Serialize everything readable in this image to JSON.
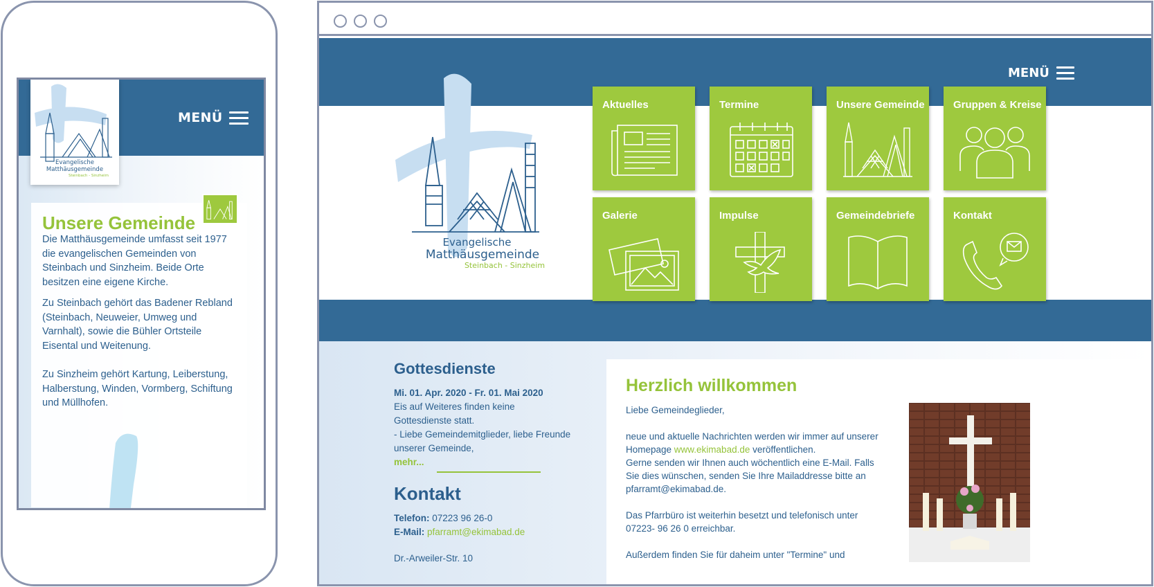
{
  "colors": {
    "brand_blue": "#336a96",
    "text_blue": "#2c5f8d",
    "accent_green": "#9ec93e",
    "frame_gray": "#8a94ad"
  },
  "logo": {
    "line1": "Evangelische",
    "line2": "Matthäusgemeinde",
    "line3": "Steinbach - Sinzheim"
  },
  "phone": {
    "menu_label": "MENÜ",
    "section_title": "Unsere Gemeinde",
    "paragraphs": [
      "Die Matthäusgemeinde umfasst seit 1977 die evangelischen Gemeinden von Steinbach und Sinzheim. Beide Orte besitzen eine eigene Kirche.",
      "Zu Steinbach gehört das Badener Rebland (Steinbach, Neuweier, Umweg und Varnhalt), sowie die Bühler Ortsteile Eisental und Weitenung.",
      "Zu Sinzheim gehört Kartung, Leiberstung, Halberstung, Winden, Vormberg, Schiftung und Müllhofen."
    ]
  },
  "site": {
    "menu_label": "MENÜ",
    "tiles": [
      {
        "label": "Aktuelles",
        "icon": "newspaper-icon"
      },
      {
        "label": "Termine",
        "icon": "calendar-icon"
      },
      {
        "label": "Unsere Gemeinde",
        "icon": "church-icon"
      },
      {
        "label": "Gruppen & Kreise",
        "icon": "group-icon"
      },
      {
        "label": "Galerie",
        "icon": "gallery-icon"
      },
      {
        "label": "Impulse",
        "icon": "cross-dove-icon"
      },
      {
        "label": "Gemeindebriefe",
        "icon": "book-icon"
      },
      {
        "label": "Kontakt",
        "icon": "phone-mail-icon"
      }
    ],
    "gottesdienste": {
      "title": "Gottesdienste",
      "date": "Mi. 01. Apr. 2020 - Fr. 01. Mai 2020",
      "body": [
        "Eis auf Weiteres finden keine",
        "Gottesdienste statt.",
        "- Liebe Gemeindemitglieder, liebe Freunde",
        "unserer Gemeinde,"
      ],
      "more": "mehr..."
    },
    "kontakt": {
      "title": "Kontakt",
      "phone_label": "Telefon:",
      "phone_value": "07223 96 26-0",
      "email_label": "E-Mail:",
      "email_value": "pfarramt@ekimabad.de",
      "address": "Dr.-Arweiler-Str. 10"
    },
    "welcome": {
      "title": "Herzlich willkommen",
      "greeting": "Liebe Gemeindeglieder,",
      "line1": "neue und aktuelle Nachrichten werden wir immer auf unserer",
      "line2_pre": "Homepage ",
      "line2_link": "www.ekimabad.de",
      "line2_post": " veröffentlichen.",
      "line3": "Gerne senden wir Ihnen auch wöchentlich eine E-Mail. Falls",
      "line4": "Sie dies wünschen, senden Sie Ihre Mailaddresse bitte an",
      "line5": "pfarramt@ekimabad.de.",
      "line6": "Das Pfarrbüro ist weiterhin besetzt und telefonisch unter",
      "line7": "07223- 96 26 0 erreichbar.",
      "line8": "Außerdem finden Sie für daheim unter \"Termine\" und"
    }
  }
}
